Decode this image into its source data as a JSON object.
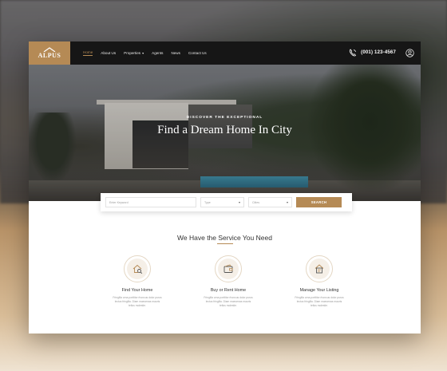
{
  "brand": {
    "logo_text": "ALPUS",
    "accent": "#b58a55",
    "dark": "#161616"
  },
  "nav": {
    "items": [
      {
        "label": "Home",
        "active": true
      },
      {
        "label": "About Us"
      },
      {
        "label": "Properties",
        "dropdown": true
      },
      {
        "label": "Agents"
      },
      {
        "label": "News"
      },
      {
        "label": "Contact Us"
      }
    ],
    "phone": "(001) 123-4567",
    "phone_icon": "phone-icon",
    "user_icon": "user-icon"
  },
  "hero": {
    "kicker": "DISCOVER THE EXCEPTIONAL",
    "title": "Find a Dream Home In City"
  },
  "search": {
    "keyword_placeholder": "Enter Keyword",
    "type_placeholder": "Type",
    "city_placeholder": "Cities",
    "button_label": "SEARCH"
  },
  "services": {
    "heading": "We Have the Service You Need",
    "items": [
      {
        "title": "Find Your Home",
        "desc_line1": "Fringilla urna porttitor rhoncus dolor purus",
        "desc_line2": "lectus fringilla. Diam maecenas mauris",
        "desc_line3": "tellus molestie.",
        "icon": "house-search-icon"
      },
      {
        "title": "Buy or Rent Home",
        "desc_line1": "Fringilla urna porttitor rhoncus dolor purus",
        "desc_line2": "lectus fringilla. Diam maecenas mauris",
        "desc_line3": "tellus molestie.",
        "icon": "wallet-icon"
      },
      {
        "title": "Manage Your Listing",
        "desc_line1": "Fringilla urna porttitor rhoncus dolor purus",
        "desc_line2": "lectus fringilla. Diam maecenas mauris",
        "desc_line3": "tellus molestie.",
        "icon": "listing-house-icon"
      }
    ]
  }
}
